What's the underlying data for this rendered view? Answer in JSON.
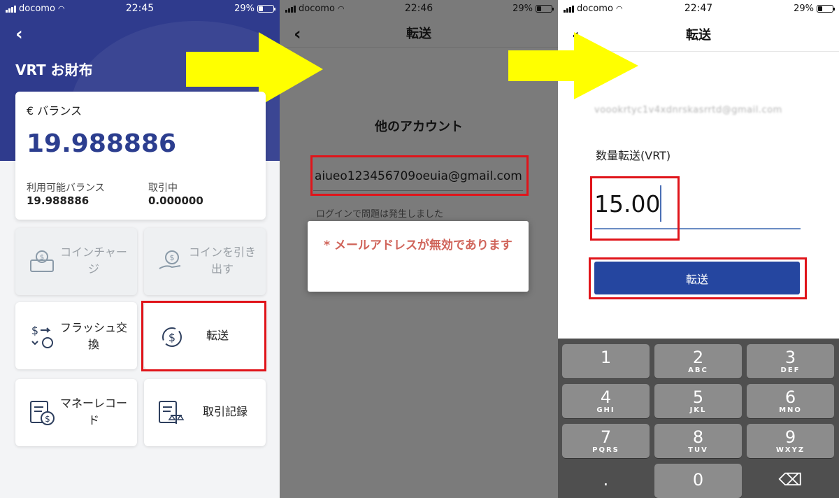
{
  "status_bars": [
    {
      "carrier": "docomo",
      "time": "22:45",
      "battery": "29%"
    },
    {
      "carrier": "docomo",
      "time": "22:46",
      "battery": "29%"
    },
    {
      "carrier": "docomo",
      "time": "22:47",
      "battery": "29%"
    }
  ],
  "wallet": {
    "title": "VRT お財布",
    "balance_label": "€ バランス",
    "balance_value": "19.988886",
    "available_label": "利用可能バランス",
    "available_value": "19.988886",
    "pending_label": "取引中",
    "pending_value": "0.000000",
    "tiles": [
      {
        "label": "コインチャージ",
        "icon": "coin-charge-icon",
        "enabled": false
      },
      {
        "label": "コインを引き出す",
        "icon": "coin-withdraw-icon",
        "enabled": false
      },
      {
        "label": "フラッシュ交換",
        "icon": "flash-exchange-icon",
        "enabled": true
      },
      {
        "label": "転送",
        "icon": "transfer-icon",
        "enabled": true
      },
      {
        "label": "マネーレコード",
        "icon": "money-record-icon",
        "enabled": true
      },
      {
        "label": "取引記録",
        "icon": "transaction-record-icon",
        "enabled": true
      }
    ]
  },
  "transfer_account": {
    "title": "転送",
    "heading": "他のアカウント",
    "email_value": "aiueo123456709oeuia@gmail.com",
    "hint": "ログインで問題は発生しました",
    "alert_message": "* メールアドレスが無効であります"
  },
  "transfer_amount": {
    "title": "転送",
    "recipient_address": "voookrtyc1v4xdnrskasrrtd@gmail.com",
    "quantity_label": "数量転送(VRT)",
    "amount_value": "15.00",
    "send_label": "転送"
  },
  "keypad": [
    {
      "main": "1",
      "sub": ""
    },
    {
      "main": "2",
      "sub": "ABC"
    },
    {
      "main": "3",
      "sub": "DEF"
    },
    {
      "main": "4",
      "sub": "GHI"
    },
    {
      "main": "5",
      "sub": "JKL"
    },
    {
      "main": "6",
      "sub": "MNO"
    },
    {
      "main": "7",
      "sub": "PQRS"
    },
    {
      "main": "8",
      "sub": "TUV"
    },
    {
      "main": "9",
      "sub": "WXYZ"
    },
    {
      "main": ".",
      "sub": ""
    },
    {
      "main": "0",
      "sub": ""
    },
    {
      "main": "⌫",
      "sub": ""
    }
  ],
  "colors": {
    "header_blue": "#2f3b8d",
    "balance_blue": "#2c3e8f",
    "send_button": "#2546a0",
    "highlight_red": "#e0141a",
    "arrow_yellow": "#ffff00",
    "alert_text": "#d0645a"
  }
}
